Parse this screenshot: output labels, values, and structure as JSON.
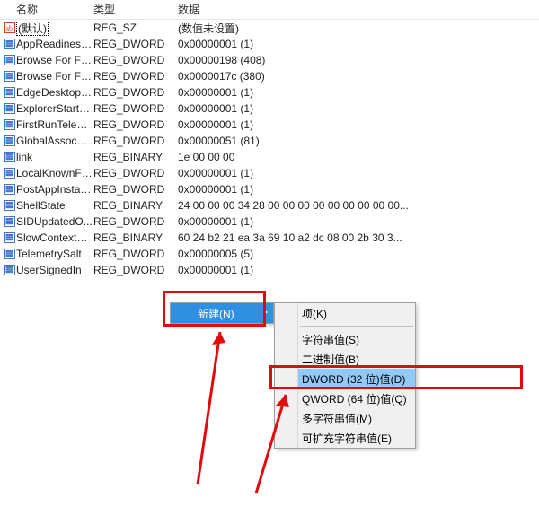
{
  "headers": {
    "name": "名称",
    "type": "类型",
    "data": "数据"
  },
  "rows": [
    {
      "icon": "sz",
      "name": "(默认)",
      "type": "REG_SZ",
      "data": "(数值未设置)",
      "default": true
    },
    {
      "icon": "dw",
      "name": "AppReadiness...",
      "type": "REG_DWORD",
      "data": "0x00000001 (1)"
    },
    {
      "icon": "dw",
      "name": "Browse For Fol...",
      "type": "REG_DWORD",
      "data": "0x00000198 (408)"
    },
    {
      "icon": "dw",
      "name": "Browse For Fol...",
      "type": "REG_DWORD",
      "data": "0x0000017c (380)"
    },
    {
      "icon": "dw",
      "name": "EdgeDesktopS...",
      "type": "REG_DWORD",
      "data": "0x00000001 (1)"
    },
    {
      "icon": "dw",
      "name": "ExplorerStartu...",
      "type": "REG_DWORD",
      "data": "0x00000001 (1)"
    },
    {
      "icon": "dw",
      "name": "FirstRunTelem...",
      "type": "REG_DWORD",
      "data": "0x00000001 (1)"
    },
    {
      "icon": "dw",
      "name": "GlobalAssocCh...",
      "type": "REG_DWORD",
      "data": "0x00000051 (81)"
    },
    {
      "icon": "dw",
      "name": "link",
      "type": "REG_BINARY",
      "data": "1e 00 00 00"
    },
    {
      "icon": "dw",
      "name": "LocalKnownFol...",
      "type": "REG_DWORD",
      "data": "0x00000001 (1)"
    },
    {
      "icon": "dw",
      "name": "PostAppInstall...",
      "type": "REG_DWORD",
      "data": "0x00000001 (1)"
    },
    {
      "icon": "dw",
      "name": "ShellState",
      "type": "REG_BINARY",
      "data": "24 00 00 00 34 28 00 00 00 00 00 00 00 00 00..."
    },
    {
      "icon": "dw",
      "name": "SIDUpdatedO...",
      "type": "REG_DWORD",
      "data": "0x00000001 (1)"
    },
    {
      "icon": "dw",
      "name": "SlowContextM...",
      "type": "REG_BINARY",
      "data": "60 24 b2 21 ea 3a 69 10 a2 dc 08 00 2b 30 3..."
    },
    {
      "icon": "dw",
      "name": "TelemetrySalt",
      "type": "REG_DWORD",
      "data": "0x00000005 (5)"
    },
    {
      "icon": "dw",
      "name": "UserSignedIn",
      "type": "REG_DWORD",
      "data": "0x00000001 (1)"
    }
  ],
  "ctx1": {
    "new": "新建(N)"
  },
  "ctx2": {
    "key": "项(K)",
    "string": "字符串值(S)",
    "binary": "二进制值(B)",
    "dword": "DWORD (32 位)值(D)",
    "qword": "QWORD (64 位)值(Q)",
    "multi": "多字符串值(M)",
    "expand": "可扩充字符串值(E)"
  }
}
